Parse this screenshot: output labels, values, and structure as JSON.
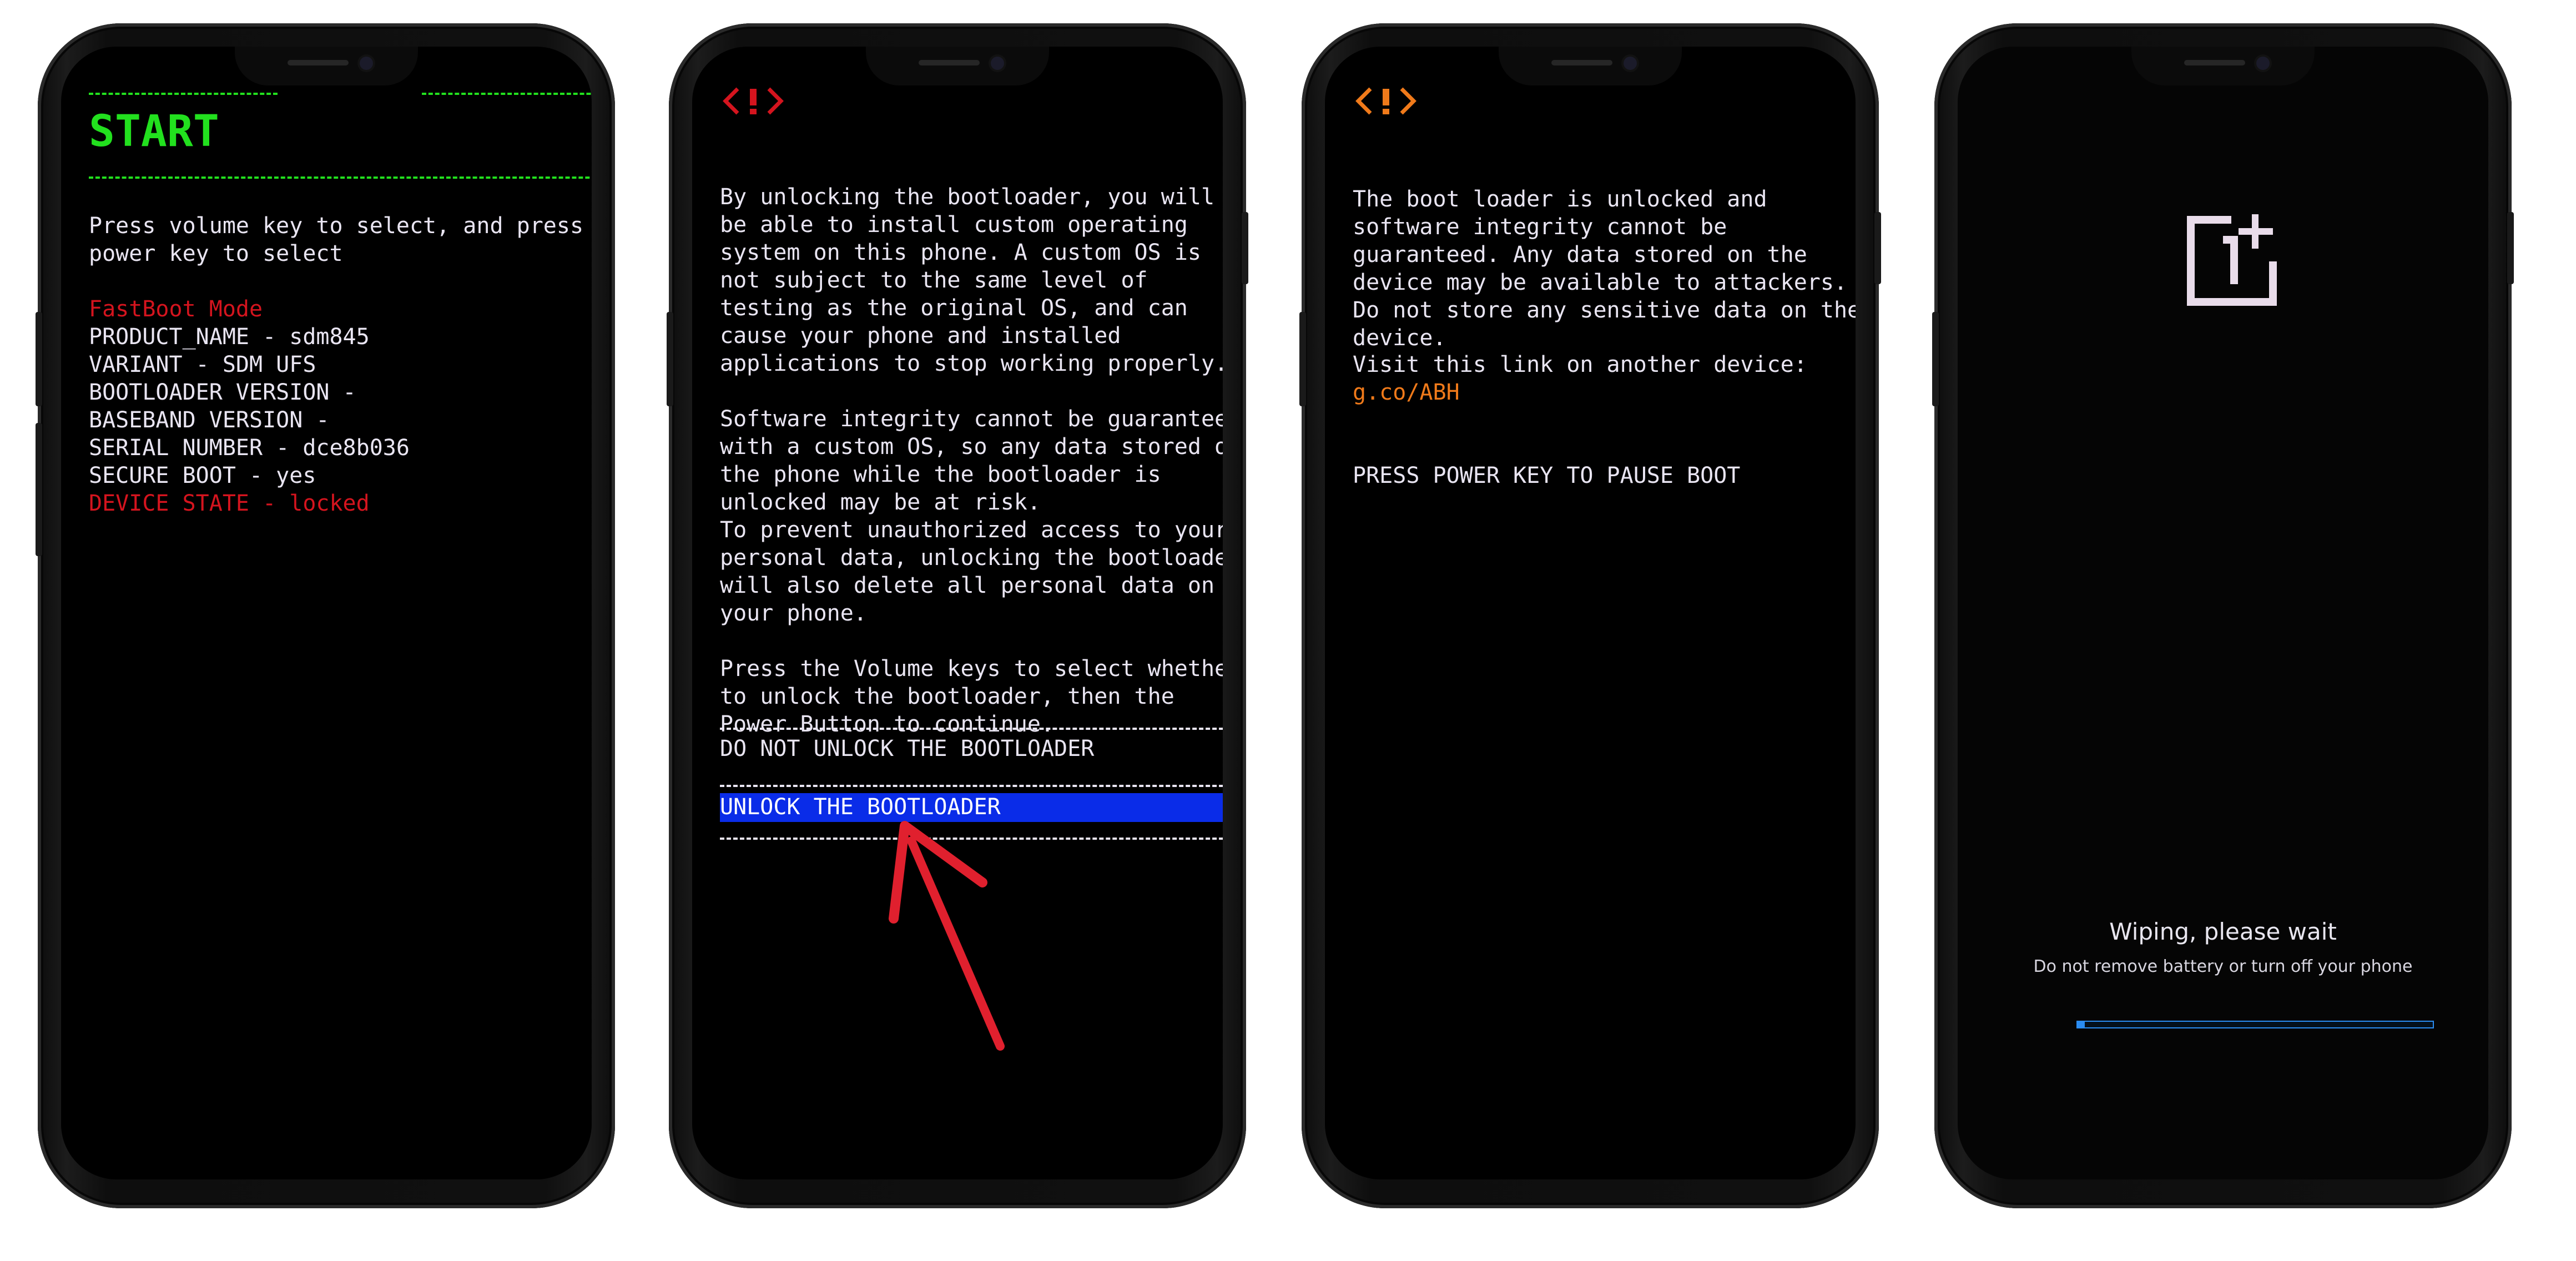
{
  "screens": [
    {
      "id": "fastboot",
      "title": "START",
      "instruction": "Press volume key to select, and press power key to select",
      "mode": "FastBoot Mode",
      "info": [
        "PRODUCT_NAME - sdm845",
        "VARIANT - SDM UFS",
        "BOOTLOADER VERSION -",
        "BASEBAND VERSION -",
        "SERIAL NUMBER - dce8b036",
        "SECURE BOOT - yes"
      ],
      "device_state": "DEVICE STATE - locked",
      "colors": {
        "title": "#22e01e",
        "mode": "#d4141e",
        "text": "#e9e5f2"
      }
    },
    {
      "id": "unlock-confirm",
      "warning_icon": "warning-icon",
      "paragraphs": [
        "By unlocking the bootloader, you will be able to install custom operating system on this phone. A custom OS is not subject to the same level of testing as the original OS, and can cause your phone and installed applications to stop working properly.",
        "Software integrity cannot be guaranteed with a custom OS, so any data stored on the phone while the bootloader is unlocked may be at risk.",
        "To prevent unauthorized access to your personal data, unlocking the bootloader will also delete all personal data on your phone.",
        "Press the Volume keys to select whether to unlock the bootloader, then the Power Button to continue."
      ],
      "options": [
        {
          "label": "DO NOT UNLOCK THE BOOTLOADER",
          "selected": false
        },
        {
          "label": "UNLOCK THE BOOTLOADER",
          "selected": true
        }
      ],
      "colors": {
        "icon": "#d4141e",
        "highlight": "#0a2ce8"
      }
    },
    {
      "id": "unlocked-warning",
      "warning_icon": "warning-icon",
      "message": "The boot loader is unlocked and software integrity cannot be guaranteed. Any data stored on the device may be available to attackers. Do not store any sensitive data on the device.",
      "visit_label": "Visit this link on another device:",
      "link": "g.co/ABH",
      "action": "PRESS POWER KEY TO PAUSE BOOT",
      "colors": {
        "icon": "#f07a1a",
        "link": "#f07a1a"
      }
    },
    {
      "id": "wiping",
      "logo_icon": "oneplus-logo-icon",
      "status": "Wiping, please wait",
      "subtext": "Do not remove battery or turn off your phone",
      "progress": 0.02,
      "colors": {
        "logo": "#e9dcea",
        "progress": "#2a8cf2"
      }
    }
  ],
  "annotation": {
    "arrow_color": "#e0202e",
    "icon": "red-arrow-icon"
  }
}
